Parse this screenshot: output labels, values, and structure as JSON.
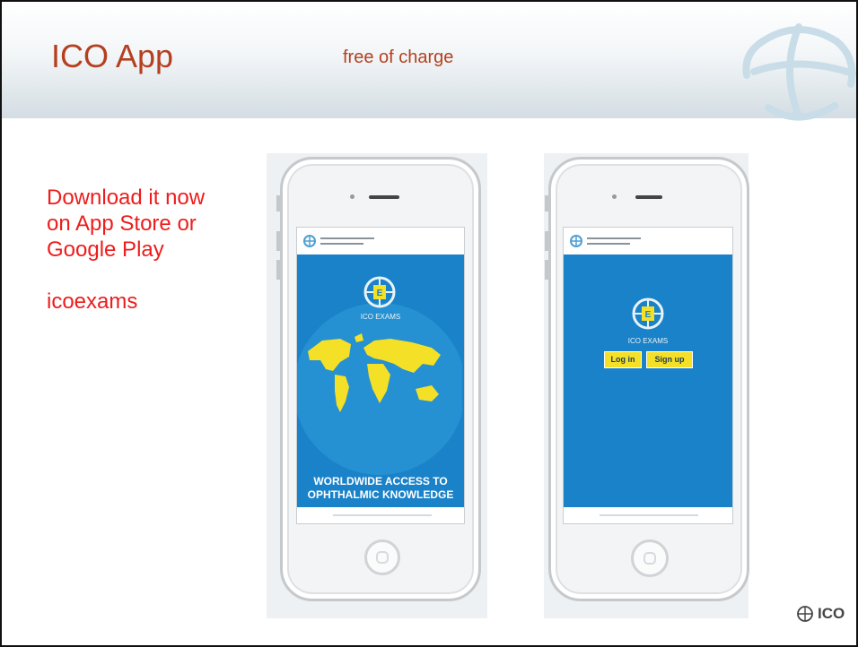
{
  "header": {
    "title": "ICO App",
    "subtitle": "free of charge"
  },
  "left_panel": {
    "lines": [
      "Download it now",
      "on App Store or",
      "Google Play"
    ],
    "search_term": "icoexams"
  },
  "phone_left": {
    "app_name": "ICO EXAMS",
    "tagline_line1": "WORLDWIDE ACCESS TO",
    "tagline_line2": "OPHTHALMIC KNOWLEDGE"
  },
  "phone_right": {
    "app_name": "ICO EXAMS",
    "login_label": "Log in",
    "signup_label": "Sign up"
  },
  "footer": {
    "brand": "ICO"
  },
  "colors": {
    "title": "#b4401f",
    "text_red": "#ee1c1c",
    "app_blue": "#1a82c8",
    "app_yellow": "#f4e026"
  }
}
